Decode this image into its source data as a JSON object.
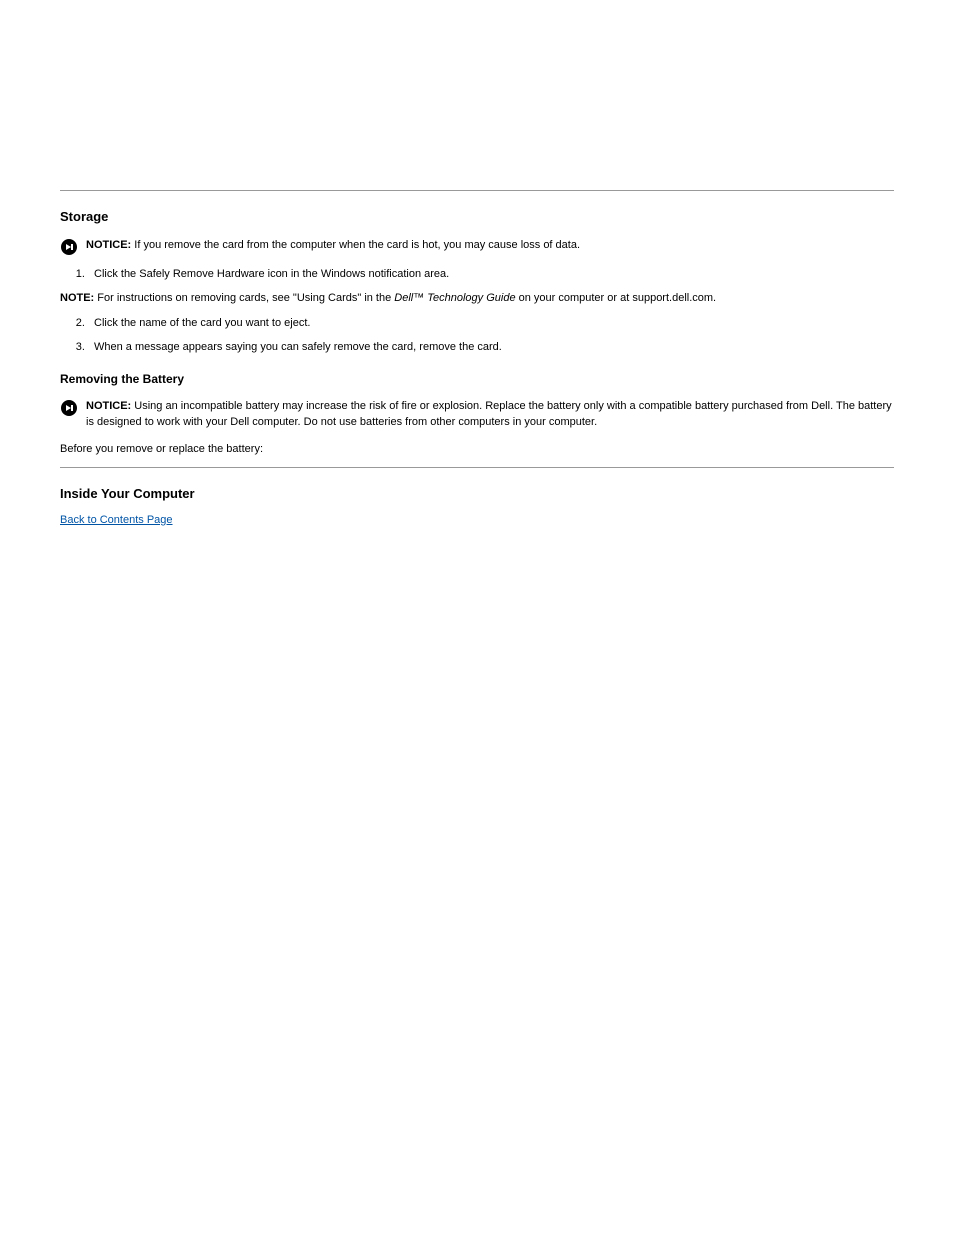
{
  "sections": {
    "storage_title": "Storage",
    "notice1_label": "NOTICE:",
    "notice1_text": " If you remove the card from the computer when the card is hot, you may cause loss of data.",
    "step1": "Click the Safely Remove Hardware icon in the Windows notification area.",
    "note1_label": "NOTE:",
    "note1_text_before": " For instructions on removing cards, see \"Using Cards\" in the ",
    "note1_italic": "Dell™ Technology Guide",
    "note1_text_after": " on your computer or at support.dell.com.",
    "step2": "Click the name of the card you want to eject.",
    "step3": "When a message appears saying you can safely remove the card, remove the card.",
    "battery_title": "Removing the Battery",
    "notice2_label": "NOTICE:",
    "notice2_text": " Using an incompatible battery may increase the risk of fire or explosion. Replace the battery only with a compatible battery purchased from Dell. The battery is designed to work with your Dell computer. Do not use batteries from other computers in your computer.",
    "para_inside": "Before you remove or replace the battery:",
    "inside_title": "Inside Your Computer",
    "link_text": "Back to Contents Page"
  }
}
